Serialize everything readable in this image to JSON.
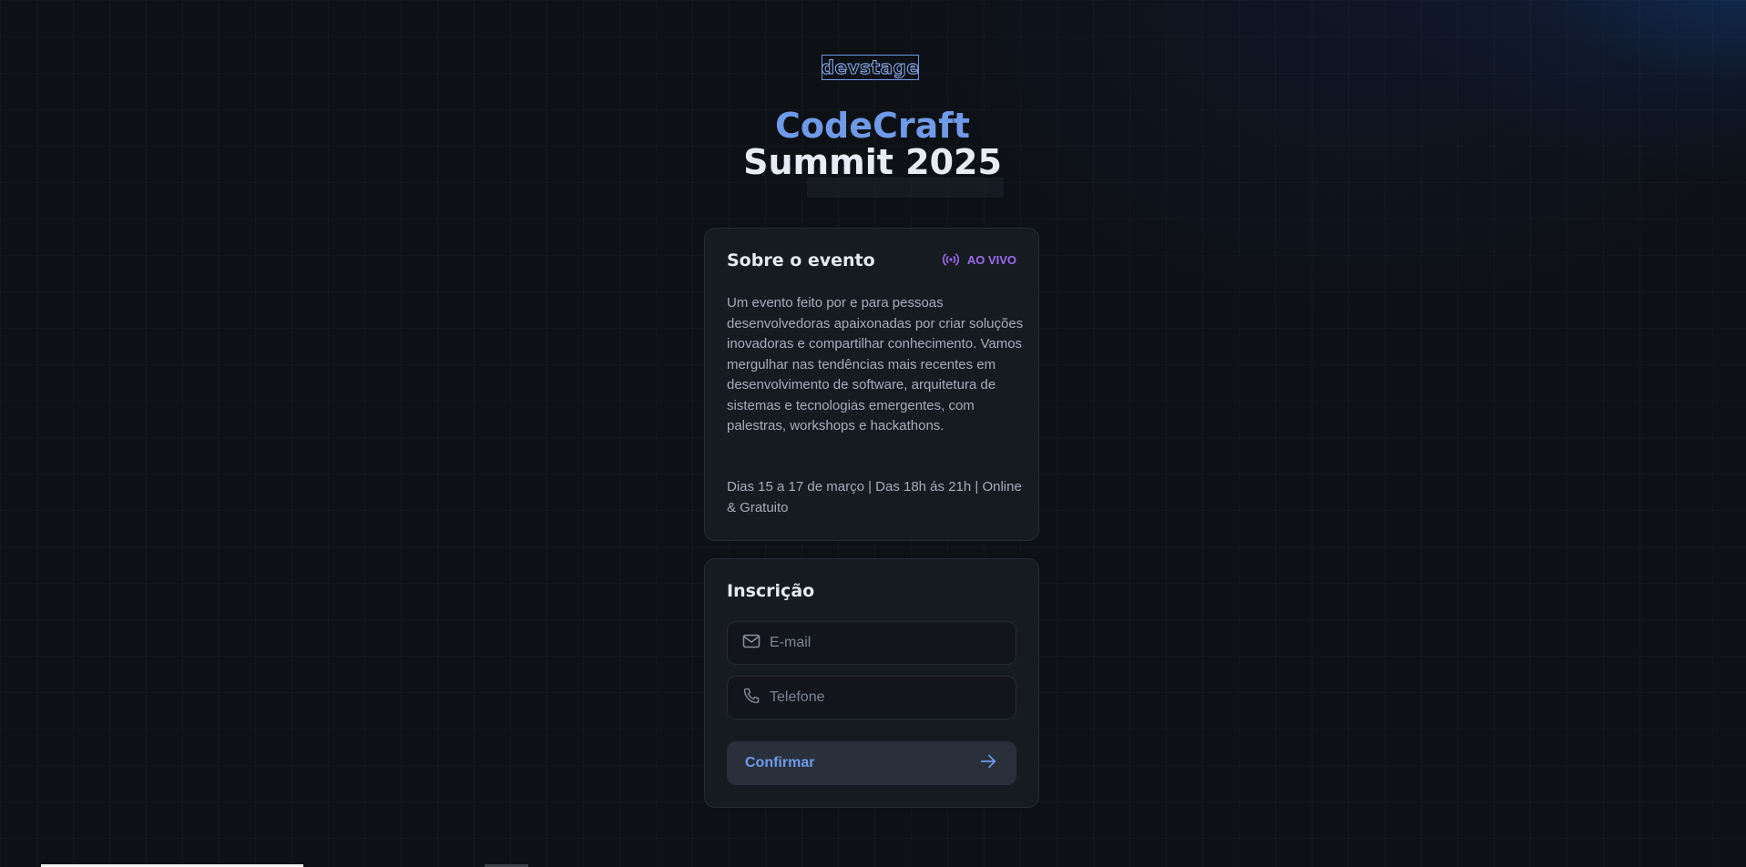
{
  "brand": {
    "logo_text": "devstage"
  },
  "hero": {
    "title_line1": "CodeCraft",
    "title_line2": "Summit 2025"
  },
  "about": {
    "title": "Sobre o evento",
    "badge_label": "AO VIVO",
    "badge_icon": "radio-broadcast-icon",
    "description": "Um evento feito por e para pessoas desenvolvedoras apaixonadas por criar soluções inovadoras e compartilhar conhecimento. Vamos mergulhar nas tendências mais recentes em desenvolvimento de software, arquitetura de sistemas e tecnologias emergentes, com palestras, workshops e hackathons.",
    "dates": "Dias 15 a 17 de março | Das 18h ás 21h | Online & Gratuito"
  },
  "form": {
    "title": "Inscrição",
    "email": {
      "placeholder": "E-mail",
      "value": "",
      "icon": "mail-icon"
    },
    "phone": {
      "placeholder": "Telefone",
      "value": "",
      "icon": "phone-icon"
    },
    "submit_label": "Confirmar",
    "submit_icon": "arrow-right-icon"
  },
  "colors": {
    "accent_blue": "#6f9ae8",
    "accent_purple": "#9b6cf2",
    "background": "#0d1015",
    "card": "#161a21"
  }
}
